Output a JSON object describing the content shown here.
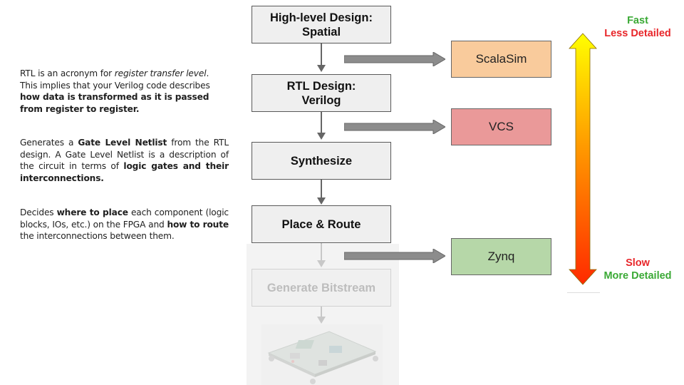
{
  "descriptions": [
    {
      "segments": [
        {
          "text": "RTL is an acronym for ",
          "style": "normal"
        },
        {
          "text": "register transfer level",
          "style": "italic"
        },
        {
          "text": ". This implies that your Verilog code describes ",
          "style": "normal"
        },
        {
          "text": "how data is transformed as it is passed from register to register.",
          "style": "bold"
        }
      ]
    },
    {
      "segments": [
        {
          "text": "Generates a ",
          "style": "normal"
        },
        {
          "text": "Gate Level Netlist",
          "style": "bold"
        },
        {
          "text": " from the RTL design. A Gate Level Netlist is a description of the circuit in terms of ",
          "style": "normal"
        },
        {
          "text": "logic gates and their interconnections.",
          "style": "bold"
        }
      ]
    },
    {
      "segments": [
        {
          "text": "Decides ",
          "style": "normal"
        },
        {
          "text": "where to place",
          "style": "bold"
        },
        {
          "text": " each component (logic blocks, IOs, etc.) on the FPGA and ",
          "style": "normal"
        },
        {
          "text": "how to route",
          "style": "bold"
        },
        {
          "text": " the interconnections between them.",
          "style": "normal"
        }
      ]
    }
  ],
  "flow_steps": [
    {
      "line1": "High-level Design:",
      "line2": "Spatial",
      "faded": false
    },
    {
      "line1": "RTL Design:",
      "line2": "Verilog",
      "faded": false
    },
    {
      "line1": "Synthesize",
      "line2": "",
      "faded": false
    },
    {
      "line1": "Place & Route",
      "line2": "",
      "faded": false
    },
    {
      "line1": "Generate Bitstream",
      "line2": "",
      "faded": true
    }
  ],
  "targets": [
    {
      "label": "ScalaSim",
      "color": "#f9cb9c"
    },
    {
      "label": "VCS",
      "color": "#ea9999"
    },
    {
      "label": "Zynq",
      "color": "#b6d7a8"
    }
  ],
  "speed_scale": {
    "top_line1": "Fast",
    "top_line2": "Less Detailed",
    "bottom_line1": "Slow",
    "bottom_line2": "More Detailed",
    "green": "#3aa935",
    "red": "#e8262a",
    "gradient_top": "#ffff00",
    "gradient_bottom": "#ff2a00"
  },
  "fpga_board_image": "fpga-board"
}
